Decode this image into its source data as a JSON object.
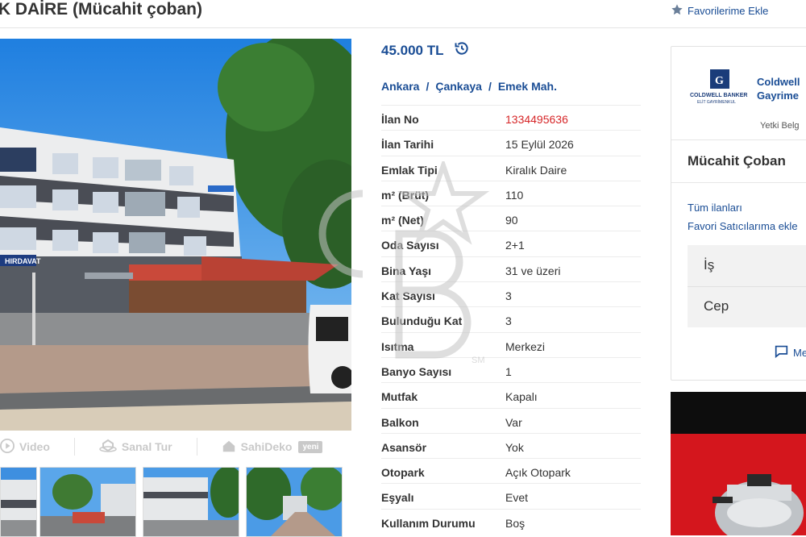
{
  "header": {
    "title": "IK DAİRE (Mücahit çoban)",
    "favorite_label": "Favorilerime Ekle"
  },
  "gallery": {
    "video_label": "Video",
    "virtual_tour_label": "Sanal Tur",
    "sahideko_label": "SahiDeko",
    "new_badge": "yeni",
    "shop_sign": "HIRDAVAT"
  },
  "listing": {
    "price": "45.000 TL",
    "breadcrumb": [
      "Ankara",
      "Çankaya",
      "Emek Mah."
    ],
    "details": [
      {
        "label": "İlan No",
        "value": "1334495636"
      },
      {
        "label": "İlan Tarihi",
        "value": "15 Eylül 2026"
      },
      {
        "label": "Emlak Tipi",
        "value": "Kiralık Daire"
      },
      {
        "label": "m² (Brüt)",
        "value": "110"
      },
      {
        "label": "m² (Net)",
        "value": "90"
      },
      {
        "label": "Oda Sayısı",
        "value": "2+1"
      },
      {
        "label": "Bina Yaşı",
        "value": "31 ve üzeri"
      },
      {
        "label": "Kat Sayısı",
        "value": "3"
      },
      {
        "label": "Bulunduğu Kat",
        "value": "3"
      },
      {
        "label": "Isıtma",
        "value": "Merkezi"
      },
      {
        "label": "Banyo Sayısı",
        "value": "1"
      },
      {
        "label": "Mutfak",
        "value": "Kapalı"
      },
      {
        "label": "Balkon",
        "value": "Var"
      },
      {
        "label": "Asansör",
        "value": "Yok"
      },
      {
        "label": "Otopark",
        "value": "Açık Otopark"
      },
      {
        "label": "Eşyalı",
        "value": "Evet"
      },
      {
        "label": "Kullanım Durumu",
        "value": "Boş"
      }
    ],
    "watermark_text": "SM"
  },
  "seller": {
    "logo_brand": "COLDWELL BANKER",
    "logo_sub": "ELİT GAYRİMENKUL",
    "company_line1": "Coldwell",
    "company_line2": "Gayrime",
    "authority": "Yetki Belg",
    "agent_name": "Mücahit Çoban",
    "all_listings": "Tüm ilanları",
    "add_favorite_seller": "Favori Satıcılarıma ekle",
    "phone_work_label": "İş",
    "phone_mobile_label": "Cep",
    "message_label": "Me"
  },
  "colors": {
    "accent_blue": "#1a4d95",
    "listing_no_red": "#d62628",
    "muted_gray": "#c9c9c9"
  }
}
